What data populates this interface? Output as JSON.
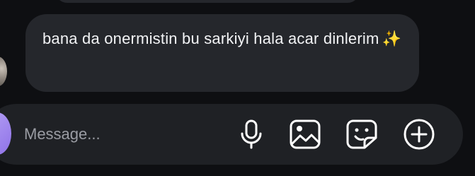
{
  "thread": {
    "incoming_message": {
      "text": "bana da onermistin bu sarkiyi hala acar dinlerim",
      "emoji": "✨"
    }
  },
  "composer": {
    "placeholder": "Message...",
    "value": "",
    "icons": [
      "microphone-icon",
      "image-icon",
      "sticker-icon",
      "add-icon"
    ]
  },
  "colors": {
    "background": "#0e0f12",
    "bubble": "#25272c",
    "composer": "#1f2125",
    "text": "#f2f3f5",
    "placeholder": "#9a9ca3",
    "avatar_accent": "#a58cf0"
  }
}
